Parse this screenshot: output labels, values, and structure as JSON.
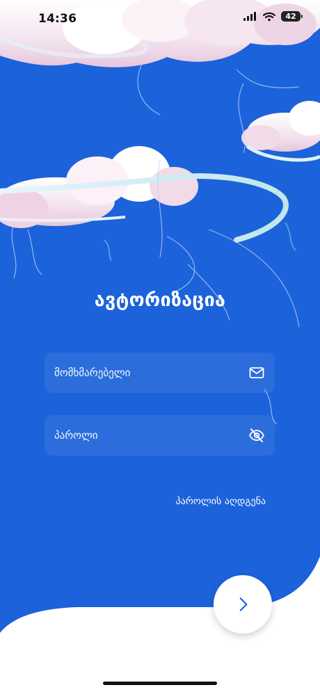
{
  "status_bar": {
    "time": "14:36",
    "battery": "42"
  },
  "login": {
    "title": "ავტორიზაცია",
    "username_placeholder": "მომხმარებელი",
    "password_placeholder": "პაროლი",
    "forgot_password": "პაროლის აღდგენა"
  },
  "colors": {
    "background": "#1c62da",
    "accent": "#1c62da",
    "panel": "#ffffff"
  },
  "icons": {
    "username": "mail-icon",
    "password": "eye-off-icon",
    "submit": "chevron-right-icon"
  }
}
